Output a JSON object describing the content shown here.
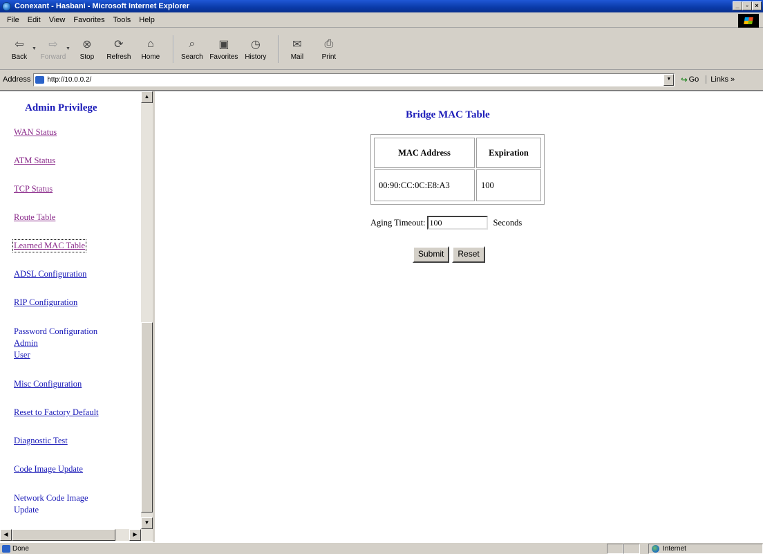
{
  "window": {
    "title": "Conexant - Hasbani - Microsoft Internet Explorer",
    "min": "_",
    "max": "▫",
    "close": "×"
  },
  "menu": [
    "File",
    "Edit",
    "View",
    "Favorites",
    "Tools",
    "Help"
  ],
  "toolbar": {
    "back": "Back",
    "forward": "Forward",
    "stop": "Stop",
    "refresh": "Refresh",
    "home": "Home",
    "search": "Search",
    "favorites": "Favorites",
    "history": "History",
    "mail": "Mail",
    "print": "Print"
  },
  "address": {
    "label": "Address",
    "url": "http://10.0.0.2/",
    "go": "Go",
    "links": "Links »"
  },
  "sidebar": {
    "title": "Admin Privilege",
    "links": [
      "WAN Status",
      "ATM Status",
      "TCP Status",
      "Route Table",
      "Learned MAC Table",
      "ADSL Configuration",
      "RIP Configuration"
    ],
    "password": {
      "label": "Password Configuration",
      "admin": "Admin",
      "user": "User"
    },
    "links2": [
      "Misc Configuration",
      "Reset to Factory Default",
      "Diagnostic Test",
      "Code Image Update",
      "Network Code Image",
      "Update"
    ]
  },
  "main": {
    "title": "Bridge MAC Table",
    "table": {
      "headers": [
        "MAC Address",
        "Expiration"
      ],
      "rows": [
        [
          "00:90:CC:0C:E8:A3",
          "100"
        ]
      ]
    },
    "aging": {
      "label": "Aging Timeout:",
      "value": "100",
      "unit": "Seconds"
    },
    "submit": "Submit",
    "reset": "Reset"
  },
  "status": {
    "text": "Done",
    "zone": "Internet"
  }
}
